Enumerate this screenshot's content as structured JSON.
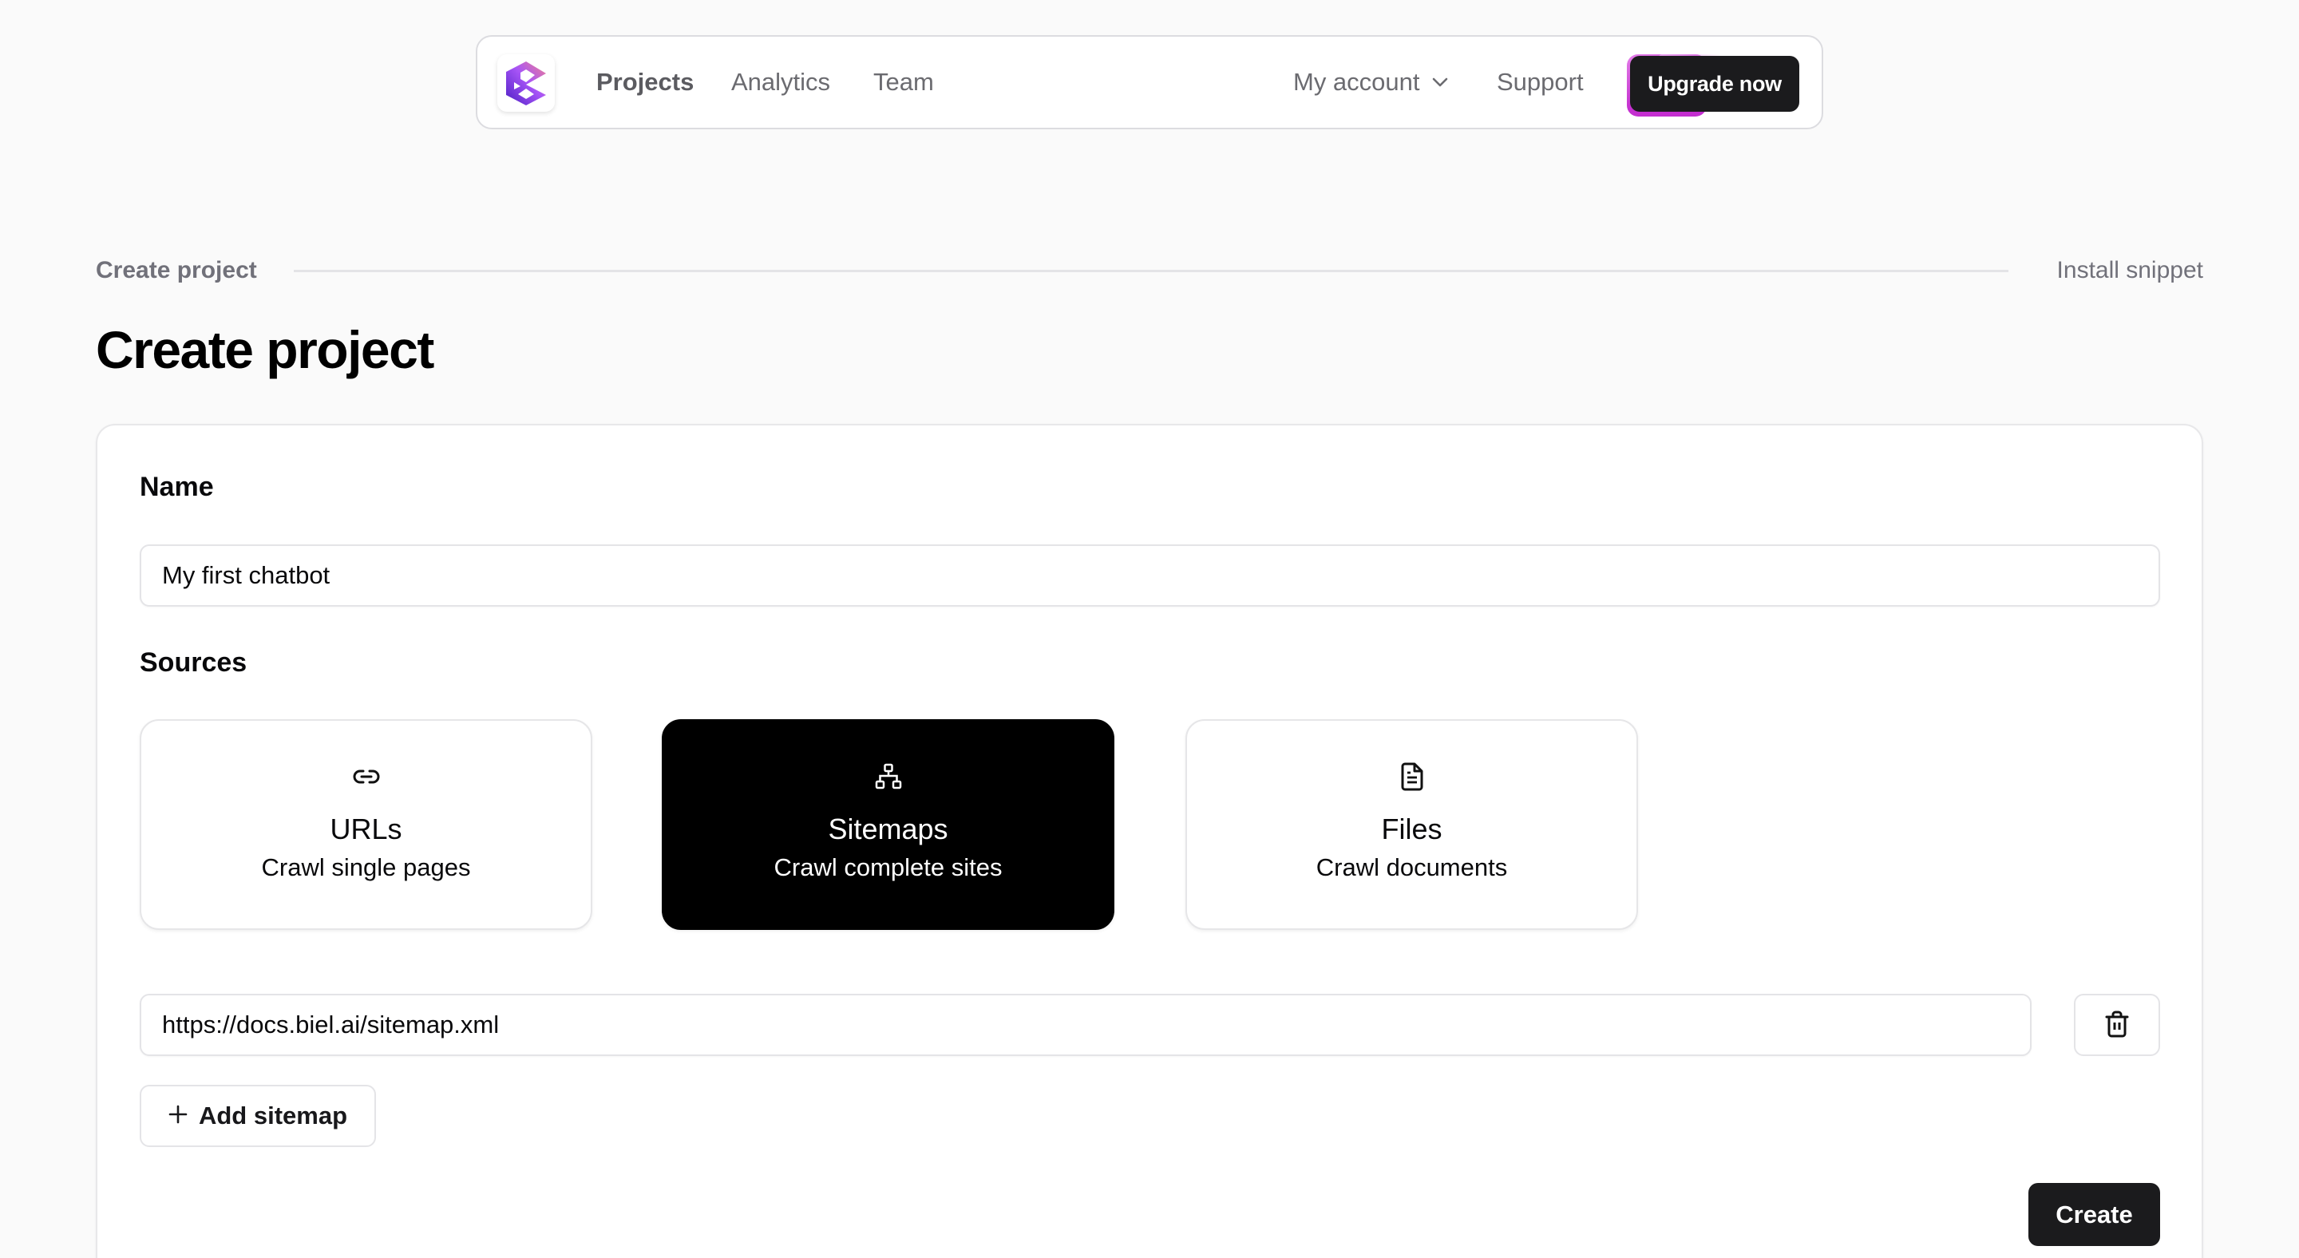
{
  "nav": {
    "logo_alt": "Biel logo",
    "links": [
      {
        "label": "Projects",
        "active": true
      },
      {
        "label": "Analytics",
        "active": false
      },
      {
        "label": "Team",
        "active": false
      }
    ],
    "account_label": "My account",
    "support_label": "Support",
    "upgrade_label": "Upgrade now",
    "icons": {
      "logo": "biel-logo",
      "account": "chevron-down-icon"
    }
  },
  "stepper": {
    "steps": [
      {
        "label": "Create project",
        "current": true
      },
      {
        "label": "Install snippet",
        "current": false
      }
    ]
  },
  "page": {
    "title": "Create project"
  },
  "form": {
    "name_label": "Name",
    "name_value": "My first chatbot",
    "sources_label": "Sources",
    "sources": [
      {
        "title": "URLs",
        "subtitle": "Crawl single pages",
        "icon": "link-icon",
        "selected": false
      },
      {
        "title": "Sitemaps",
        "subtitle": "Crawl complete sites",
        "icon": "sitemap-icon",
        "selected": true
      },
      {
        "title": "Files",
        "subtitle": "Crawl documents",
        "icon": "file-text-icon",
        "selected": false
      }
    ],
    "sitemaps": [
      {
        "value": "https://docs.biel.ai/sitemap.xml"
      }
    ],
    "add_sitemap_label": "Add sitemap",
    "create_label": "Create"
  },
  "colors": {
    "background": "#fafafa",
    "primary_button": "#1b1b1d",
    "selected_card": "#000000",
    "muted_text": "#71717a",
    "upgrade_glow": "#c530d0",
    "brand_gradient": [
      "#5b2bd6",
      "#a855f7",
      "#ef7a9a"
    ]
  }
}
